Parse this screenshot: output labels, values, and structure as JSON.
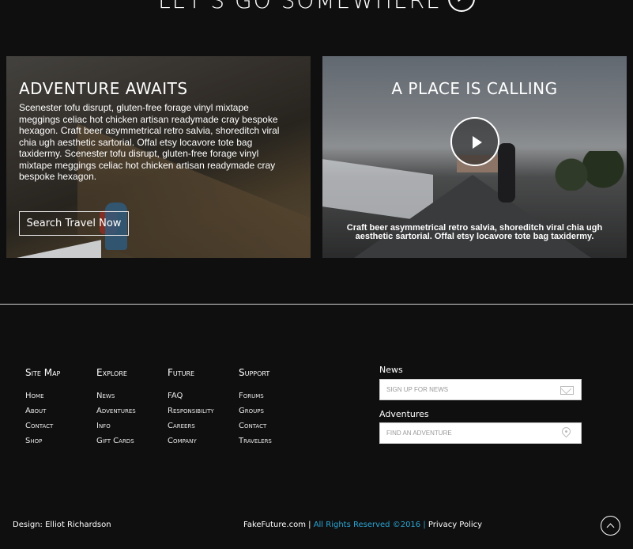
{
  "hero": {
    "title": "LET'S GO SOMEWHERE"
  },
  "panels": {
    "left": {
      "title": "ADVENTURE AWAITS",
      "text": "Scenester tofu disrupt, gluten-free forage vinyl mixtape meggings celiac hot chicken artisan readymade cray bespoke hexagon. Craft beer asymmetrical retro salvia, shoreditch viral chia ugh aesthetic sartorial. Offal etsy locavore tote bag taxidermy. Scenester tofu disrupt, gluten-free forage vinyl mixtape meggings celiac hot chicken artisan readymade cray bespoke hexagon.",
      "button": "Search Travel Now"
    },
    "right": {
      "title": "A PLACE IS CALLING",
      "caption": "Craft beer asymmetrical retro salvia, shoreditch viral chia ugh aesthetic sartorial. Offal etsy locavore tote bag taxidermy."
    }
  },
  "footer": {
    "columns": [
      {
        "heading": "Site Map",
        "items": [
          "Home",
          "About",
          "Contact",
          "Shop"
        ]
      },
      {
        "heading": "Explore",
        "items": [
          "News",
          "Adventures",
          "Info",
          "Gift Cards"
        ]
      },
      {
        "heading": "Future",
        "items": [
          "FAQ",
          "Responsibility",
          "Careers",
          "Company"
        ]
      },
      {
        "heading": "Support",
        "items": [
          "Forums",
          "Groups",
          "Contact",
          "Travelers"
        ]
      }
    ],
    "news": {
      "label": "News",
      "placeholder": "SIGN UP FOR NEWS"
    },
    "adventures": {
      "label": "Adventures",
      "placeholder": "FIND AN ADVENTURE"
    },
    "design_credit": "Design: Elliot Richardson",
    "site": "FakeFuture.com",
    "rights": "All Rights Reserved ©2016",
    "privacy": "Privacy Policy"
  },
  "colors": {
    "background": "#0f0f0f",
    "accent": "#29a6d6",
    "text": "#ffffff"
  },
  "icons": [
    "plane-icon",
    "play-icon",
    "envelope-icon",
    "map-pin-icon",
    "chevron-up-icon"
  ]
}
